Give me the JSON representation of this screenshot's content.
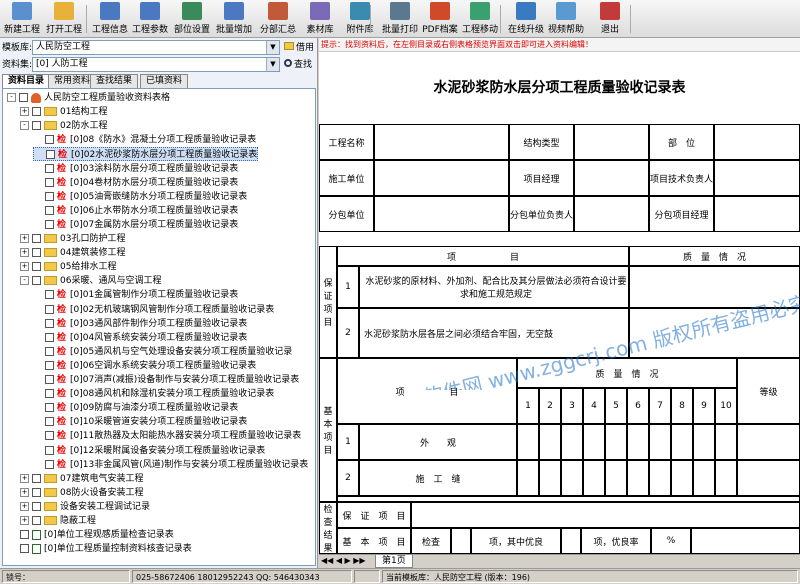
{
  "toolbar": {
    "buttons": [
      "新建工程",
      "打开工程",
      "工程信息",
      "工程参数",
      "部位设置",
      "批量增加",
      "分部汇总",
      "素材库",
      "附件库",
      "批量打印",
      "PDF档案",
      "工程移动",
      "在线升级",
      "视频帮助",
      "退出"
    ]
  },
  "left": {
    "template_label": "模板库:",
    "template_value": "人民防空工程",
    "borrow_label": "借用",
    "dataset_label": "资料集:",
    "dataset_value": "[0] 人防工程",
    "find_label": "查找",
    "tabs": [
      "资料目录",
      "常用资料",
      "查找结果",
      "已填资料"
    ],
    "jian": "检",
    "tree": [
      {
        "text": "人民防空工程质量验收资料表格",
        "lvl": 0,
        "pm": "-",
        "k": "root"
      },
      {
        "text": "01结构工程",
        "lvl": 1,
        "pm": "+",
        "k": "folder"
      },
      {
        "text": "02防水工程",
        "lvl": 1,
        "pm": "-",
        "k": "folder"
      },
      {
        "text": "[0]08《防水》混凝土分项工程质量验收记录表",
        "lvl": 2,
        "k": "doc"
      },
      {
        "text": "[0]02水泥砂浆防水层分项工程质量验收记录表",
        "lvl": 2,
        "k": "doc",
        "sel": true
      },
      {
        "text": "[0]03涂料防水层分项工程质量验收记录表",
        "lvl": 2,
        "k": "doc"
      },
      {
        "text": "[0]04卷材防水层分项工程质量验收记录表",
        "lvl": 2,
        "k": "doc"
      },
      {
        "text": "[0]05油膏嵌缝防水分项工程质量验收记录表",
        "lvl": 2,
        "k": "doc"
      },
      {
        "text": "[0]06止水带防水分项工程质量验收记录表",
        "lvl": 2,
        "k": "doc"
      },
      {
        "text": "[0]07金属防水层分项工程质量验收记录表",
        "lvl": 2,
        "k": "doc"
      },
      {
        "text": "03孔口防护工程",
        "lvl": 1,
        "pm": "+",
        "k": "folder"
      },
      {
        "text": "04建筑装修工程",
        "lvl": 1,
        "pm": "+",
        "k": "folder"
      },
      {
        "text": "05给排水工程",
        "lvl": 1,
        "pm": "+",
        "k": "folder"
      },
      {
        "text": "06采暖、通风与空调工程",
        "lvl": 1,
        "pm": "-",
        "k": "folder"
      },
      {
        "text": "[0]01金属管制作分项工程质量验收记录表",
        "lvl": 2,
        "k": "doc"
      },
      {
        "text": "[0]02无机玻璃钢风管制作分项工程质量验收记录表",
        "lvl": 2,
        "k": "doc"
      },
      {
        "text": "[0]03通风部件制作分项工程质量验收记录表",
        "lvl": 2,
        "k": "doc"
      },
      {
        "text": "[0]04风管系统安装分项工程质量验收记录表",
        "lvl": 2,
        "k": "doc"
      },
      {
        "text": "[0]05通风机与空气处理设备安装分项工程质量验收记录",
        "lvl": 2,
        "k": "doc"
      },
      {
        "text": "[0]06空调水系统安装分项工程质量验收记录表",
        "lvl": 2,
        "k": "doc"
      },
      {
        "text": "[0]07消声(减振)设备制作与安装分项工程质量验收记录表",
        "lvl": 2,
        "k": "doc"
      },
      {
        "text": "[0]08通风机和除湿机安装分项工程质量验收记录表",
        "lvl": 2,
        "k": "doc"
      },
      {
        "text": "[0]09防腐与油漆分项工程质量验收记录表",
        "lvl": 2,
        "k": "doc"
      },
      {
        "text": "[0]10采暖管道安装分项工程质量验收记录表",
        "lvl": 2,
        "k": "doc"
      },
      {
        "text": "[0]11散热器及太阳能热水器安装分项工程质量验收记录表",
        "lvl": 2,
        "k": "doc"
      },
      {
        "text": "[0]12采暖附属设备安装分项工程质量验收记录表",
        "lvl": 2,
        "k": "doc"
      },
      {
        "text": "[0]13非金属风管(风道)制作与安装分项工程质量验收记录表",
        "lvl": 2,
        "k": "doc"
      },
      {
        "text": "07建筑电气安装工程",
        "lvl": 1,
        "pm": "+",
        "k": "folder"
      },
      {
        "text": "08防火设备安装工程",
        "lvl": 1,
        "pm": "+",
        "k": "folder"
      },
      {
        "text": "设备安装工程调试记录",
        "lvl": 1,
        "pm": "+",
        "k": "folder"
      },
      {
        "text": "隐蔽工程",
        "lvl": 1,
        "pm": "+",
        "k": "folder"
      },
      {
        "text": "[0]单位工程观感质量检查记录表",
        "lvl": 1,
        "k": "doc"
      },
      {
        "text": "[0]单位工程质量控制资料核查记录表",
        "lvl": 1,
        "k": "doc"
      }
    ]
  },
  "right": {
    "hint": "提示：找到资料后，在左侧目录或右侧表格预览界面双击即可进入资料编辑！",
    "doc": {
      "title": "水泥砂浆防水层分项工程质量验收记录表",
      "project_name": "工程名称",
      "structure_type": "结构类型",
      "part": "部　位",
      "constructor": "施工单位",
      "pm": "项目经理",
      "tech_lead": "项目技术负责人",
      "sub_unit": "分包单位",
      "sub_lead": "分包单位负责人",
      "sub_pm": "分包项目经理",
      "item": "项　　　　　　目",
      "quality": "质　量　情　况",
      "guarantee": "保证项目",
      "g1": "水泥砂浆的原材料、外加剂、配合比及其分层做法必须符合设计要求和施工规范规定",
      "g2": "水泥砂浆防水层各层之间必须结合牢固，无空鼓",
      "basic": "基本项目",
      "item2": "项　　　　　目",
      "quality2": "质　量　情　况",
      "grade": "等级",
      "cols": [
        "1",
        "2",
        "3",
        "4",
        "5",
        "6",
        "7",
        "8",
        "9",
        "10"
      ],
      "b1": "外　　观",
      "b2": "施　工　缝",
      "check": "检查结果",
      "guarantee_row": "保　证　项　目",
      "basic_row": "基　本　项　目",
      "inspect": "检查",
      "of_which": "项，其中优良",
      "excellent": "项，优良率",
      "pct": "%",
      "n1": "1",
      "n2": "2"
    },
    "sheet_tab": "第1页",
    "watermark": [
      "建筑工程软件网 www.zggcrj.com 版权所有盗用必究"
    ]
  },
  "status": {
    "lock": "锁号：",
    "phone": "025-58672406 18012952243 QQ: 546430343",
    "template": "当前模板库：人民防空工程 (版本：196)"
  },
  "colors": {
    "tree_bg": "#ffffff",
    "jian": "#e00000",
    "hint": "#d00000",
    "watermark": "#1a6fc9"
  }
}
